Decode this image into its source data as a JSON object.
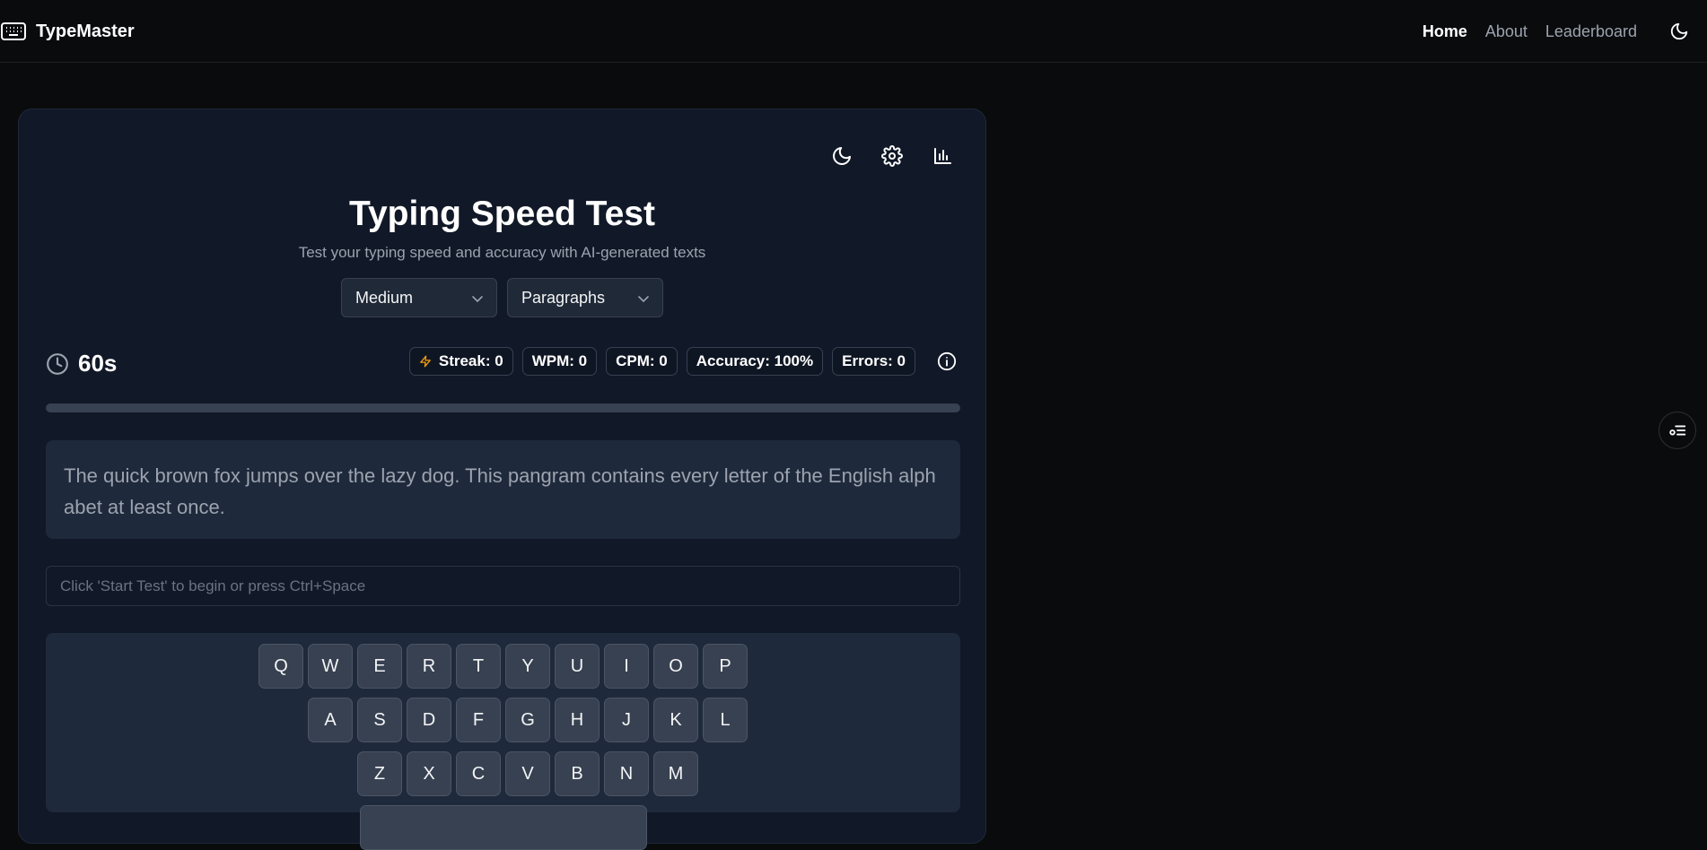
{
  "brand": {
    "name": "TypeMaster",
    "icon": "keyboard-icon"
  },
  "nav": {
    "items": [
      "Home",
      "About",
      "Leaderboard"
    ],
    "active": "Home",
    "theme_icon": "moon-icon"
  },
  "toolbar": {
    "icons": [
      "moon-icon",
      "gear-icon",
      "bar-chart-icon"
    ]
  },
  "header": {
    "title": "Typing Speed Test",
    "subtitle": "Test your typing speed and accuracy with AI-generated texts"
  },
  "selects": {
    "difficulty": "Medium",
    "mode": "Paragraphs"
  },
  "timer": {
    "value": "60s",
    "icon": "clock-icon"
  },
  "stats": {
    "streak": "Streak: 0",
    "wpm": "WPM: 0",
    "cpm": "CPM: 0",
    "accuracy": "Accuracy: 100%",
    "errors": "Errors: 0"
  },
  "progress": {
    "fraction": 0
  },
  "passage": {
    "text": "The quick brown fox jumps over the lazy dog. This pangram contains every letter of the English alphabet at least once."
  },
  "input": {
    "placeholder": "Click 'Start Test' to begin or press Ctrl+Space",
    "value": ""
  },
  "keyboard": {
    "rows": [
      [
        "Q",
        "W",
        "E",
        "R",
        "T",
        "Y",
        "U",
        "I",
        "O",
        "P"
      ],
      [
        "A",
        "S",
        "D",
        "F",
        "G",
        "H",
        "J",
        "K",
        "L"
      ],
      [
        "Z",
        "X",
        "C",
        "V",
        "B",
        "N",
        "M"
      ]
    ]
  },
  "colors": {
    "background": "#0a0b0d",
    "card": "#111827",
    "panel": "#1e293b",
    "key": "#374151",
    "streak_accent": "#f59e0b"
  }
}
